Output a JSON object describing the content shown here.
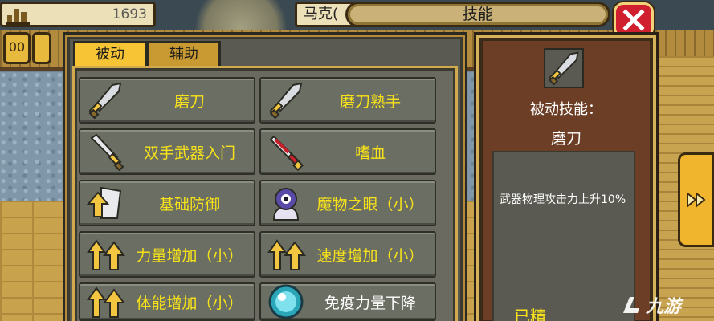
{
  "hud": {
    "gold_value": "1693",
    "character_name": "马克(",
    "left_button": "00",
    "window_title": "技能"
  },
  "tabs": [
    {
      "label": "被动",
      "active": true
    },
    {
      "label": "辅助",
      "active": false
    }
  ],
  "skills": [
    {
      "label": "磨刀",
      "icon": "sword-icon"
    },
    {
      "label": "磨刀熟手",
      "icon": "sword-icon"
    },
    {
      "label": "双手武器入门",
      "icon": "greatsword-icon"
    },
    {
      "label": "嗜血",
      "icon": "blood-dagger-icon"
    },
    {
      "label": "基础防御",
      "icon": "shield-up-icon"
    },
    {
      "label": "魔物之眼（小）",
      "icon": "monster-eye-icon"
    },
    {
      "label": "力量增加（小）",
      "icon": "strength-up-icon"
    },
    {
      "label": "速度增加（小）",
      "icon": "speed-up-icon"
    },
    {
      "label": "体能增加（小）",
      "icon": "stamina-up-icon"
    },
    {
      "label": "免疫力量下降",
      "icon": "orb-icon"
    }
  ],
  "detail": {
    "type": "被动技能：",
    "name": "磨刀",
    "description": "武器物理攻击力上升10%",
    "status": "已精"
  },
  "watermark": "九游",
  "colors": {
    "skill_text": "#f7e21a",
    "tab_active": "#f6c434",
    "close_button": "#d0202f"
  }
}
